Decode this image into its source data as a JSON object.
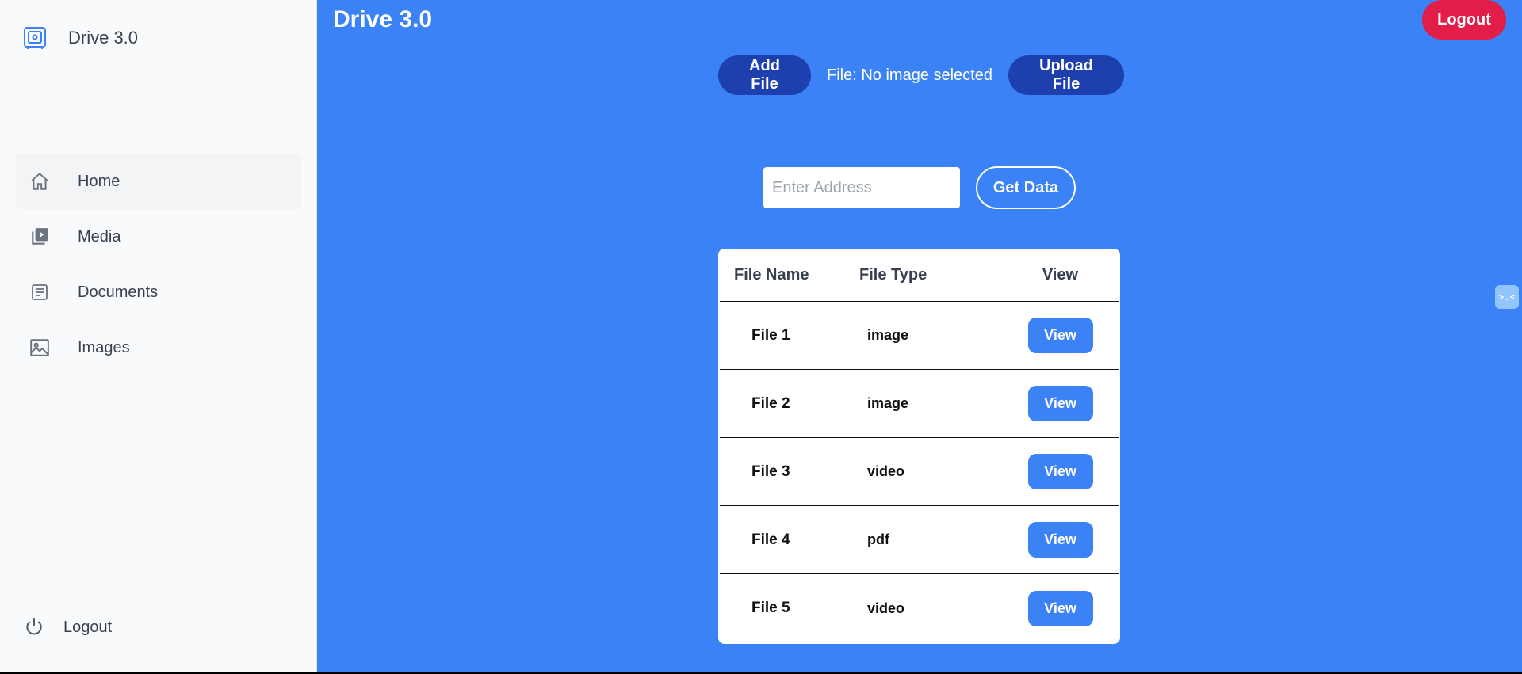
{
  "sidebar": {
    "brand": "Drive 3.0",
    "items": [
      {
        "label": "Home",
        "icon": "home-icon"
      },
      {
        "label": "Media",
        "icon": "media-icon"
      },
      {
        "label": "Documents",
        "icon": "document-icon"
      },
      {
        "label": "Images",
        "icon": "image-icon"
      }
    ],
    "logout": "Logout"
  },
  "header": {
    "title": "Drive 3.0",
    "logout": "Logout"
  },
  "upload": {
    "add_label": "Add File",
    "status": "File: No image selected",
    "upload_label": "Upload File"
  },
  "address": {
    "placeholder": "Enter Address",
    "button": "Get Data"
  },
  "table": {
    "headers": [
      "File Name",
      "File Type",
      "View"
    ],
    "rows": [
      {
        "name": "File 1",
        "type": "image",
        "action": "View"
      },
      {
        "name": "File 2",
        "type": "image",
        "action": "View"
      },
      {
        "name": "File 3",
        "type": "video",
        "action": "View"
      },
      {
        "name": "File 4",
        "type": "pdf",
        "action": "View"
      },
      {
        "name": "File 5",
        "type": "video",
        "action": "View"
      }
    ]
  },
  "widget": {
    "glyph": ">.<"
  },
  "colors": {
    "accent": "#3b82f6",
    "dark_button": "#1e40af",
    "logout": "#e11d48",
    "sidebar_bg": "#f9fafb"
  }
}
